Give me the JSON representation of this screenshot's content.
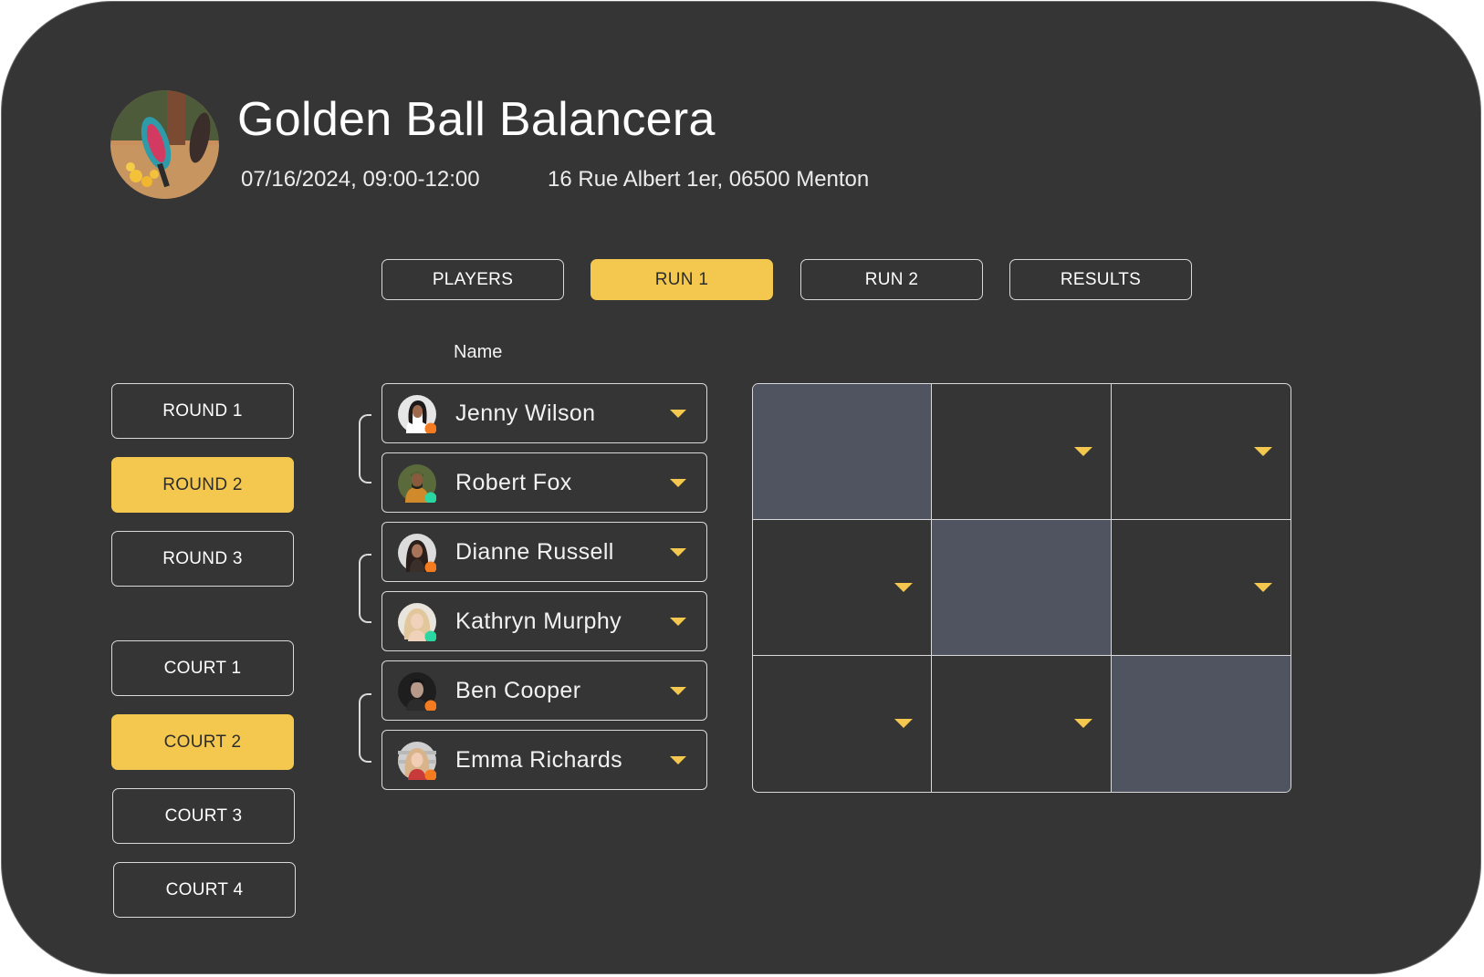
{
  "event": {
    "title": "Golden Ball Balancera",
    "datetime": "07/16/2024, 09:00-12:00",
    "address": "16 Rue Albert 1er, 06500 Menton"
  },
  "tabs": [
    {
      "label": "PLAYERS",
      "active": false
    },
    {
      "label": "RUN 1",
      "active": true
    },
    {
      "label": "RUN 2",
      "active": false
    },
    {
      "label": "RESULTS",
      "active": false
    }
  ],
  "rounds": [
    {
      "label": "ROUND 1",
      "active": false
    },
    {
      "label": "ROUND 2",
      "active": true
    },
    {
      "label": "ROUND 3",
      "active": false
    }
  ],
  "courts": [
    {
      "label": "COURT 1",
      "active": false
    },
    {
      "label": "COURT 2",
      "active": true
    },
    {
      "label": "COURT 3",
      "active": false
    },
    {
      "label": "COURT 4",
      "active": false
    }
  ],
  "table": {
    "column_header": "Name",
    "players": [
      {
        "name": "Jenny Wilson",
        "status": "orange"
      },
      {
        "name": "Robert Fox",
        "status": "green"
      },
      {
        "name": "Dianne Russell",
        "status": "orange"
      },
      {
        "name": "Kathryn Murphy",
        "status": "green"
      },
      {
        "name": "Ben Cooper",
        "status": "orange"
      },
      {
        "name": "Emma Richards",
        "status": "orange"
      }
    ]
  },
  "colors": {
    "background": "#353535",
    "accent": "#f4c84f",
    "status_orange": "#f47b20",
    "status_green": "#2ad6a1",
    "diagonal_cell": "#505460"
  }
}
